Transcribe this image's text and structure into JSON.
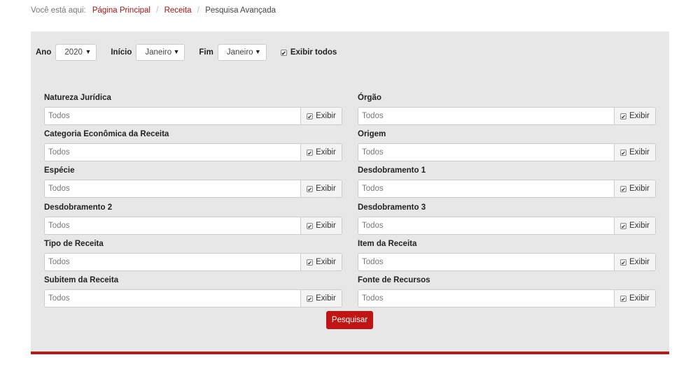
{
  "breadcrumb": {
    "prefix": "Você está aqui:",
    "items": [
      "Página Principal",
      "Receita"
    ],
    "current": "Pesquisa Avançada",
    "separator": "/"
  },
  "filters": {
    "ano": {
      "label": "Ano",
      "value": "2020"
    },
    "inicio": {
      "label": "Início",
      "value": "Janeiro"
    },
    "fim": {
      "label": "Fim",
      "value": "Janeiro"
    },
    "exibir_todos": {
      "label": "Exibir todos",
      "checked": true
    }
  },
  "fields": [
    {
      "label": "Natureza Jurídica",
      "value": "Todos",
      "addon": "Exibir"
    },
    {
      "label": "Órgão",
      "value": "Todos",
      "addon": "Exibir"
    },
    {
      "label": "Categoria Econômica da Receita",
      "value": "Todos",
      "addon": "Exibir"
    },
    {
      "label": "Origem",
      "value": "Todos",
      "addon": "Exibir"
    },
    {
      "label": "Espécie",
      "value": "Todos",
      "addon": "Exibir"
    },
    {
      "label": "Desdobramento 1",
      "value": "Todos",
      "addon": "Exibir"
    },
    {
      "label": "Desdobramento 2",
      "value": "Todos",
      "addon": "Exibir"
    },
    {
      "label": "Desdobramento 3",
      "value": "Todos",
      "addon": "Exibir"
    },
    {
      "label": "Tipo de Receita",
      "value": "Todos",
      "addon": "Exibir"
    },
    {
      "label": "Item da Receita",
      "value": "Todos",
      "addon": "Exibir"
    },
    {
      "label": "Subitem da Receita",
      "value": "Todos",
      "addon": "Exibir"
    },
    {
      "label": "Fonte de Recursos",
      "value": "Todos",
      "addon": "Exibir"
    }
  ],
  "search_button": "Pesquisar",
  "colors": {
    "accent": "#c01515",
    "panel": "#e8e7e8",
    "link": "#a31515"
  },
  "icons": {
    "checkbox": "checkbox-checked-icon",
    "dropdown": "caret-down-icon"
  }
}
